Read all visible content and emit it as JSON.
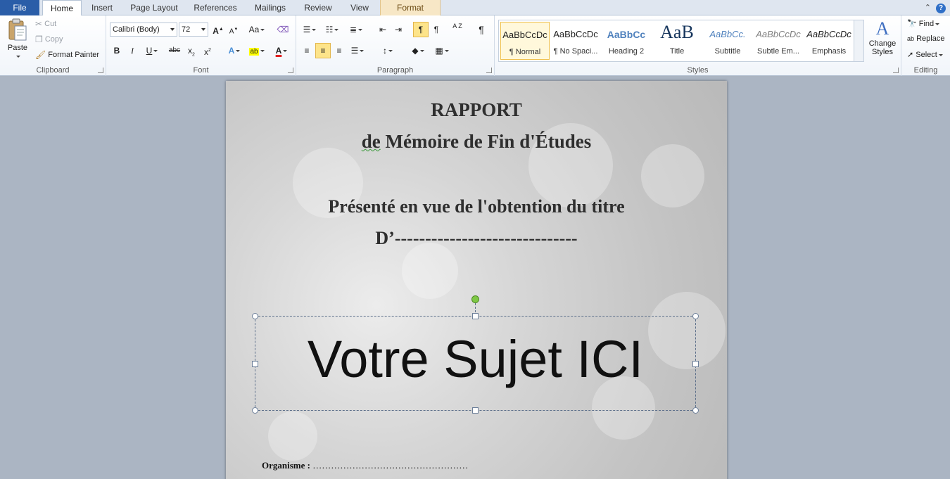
{
  "tabs": {
    "file": "File",
    "home": "Home",
    "insert": "Insert",
    "page_layout": "Page Layout",
    "references": "References",
    "mailings": "Mailings",
    "review": "Review",
    "view": "View",
    "format": "Format"
  },
  "clipboard": {
    "paste": "Paste",
    "cut": "Cut",
    "copy": "Copy",
    "format_painter": "Format Painter",
    "label": "Clipboard"
  },
  "font": {
    "family": "Calibri (Body)",
    "size": "72",
    "grow": "A",
    "shrink": "A",
    "change_case": "Aa",
    "bold": "B",
    "italic": "I",
    "underline": "U",
    "strike": "abc",
    "subscript": "x",
    "superscript": "x",
    "highlight": "ab",
    "color": "A",
    "label": "Font"
  },
  "paragraph": {
    "label": "Paragraph",
    "sort": "A Z",
    "show_marks": "¶"
  },
  "styles": {
    "label": "Styles",
    "items": [
      {
        "sample": "AaBbCcDc",
        "name": "¶ Normal"
      },
      {
        "sample": "AaBbCcDc",
        "name": "¶ No Spaci..."
      },
      {
        "sample": "AaBbCc",
        "name": "Heading 2"
      },
      {
        "sample": "AaB",
        "name": "Title"
      },
      {
        "sample": "AaBbCc.",
        "name": "Subtitle"
      },
      {
        "sample": "AaBbCcDc",
        "name": "Subtle Em..."
      },
      {
        "sample": "AaBbCcDc",
        "name": "Emphasis"
      }
    ],
    "change_styles": "Change Styles"
  },
  "editing": {
    "label": "Editing",
    "find": "Find",
    "replace": "Replace",
    "select": "Select"
  },
  "document": {
    "line1": "RAPPORT",
    "line2_a": "de",
    "line2_b": " Mémoire de Fin d'Études",
    "line3": "Présenté en vue de l'obtention  du titre",
    "line4": "D’------------------------------",
    "textbox": "Votre Sujet ICI",
    "org_label": "Organisme : ",
    "org_dots": "……………………………………………"
  },
  "colors": {
    "file_tab": "#2a5da8",
    "accent_highlight": "#fde48a",
    "context_tab": "#f7e7c6"
  }
}
